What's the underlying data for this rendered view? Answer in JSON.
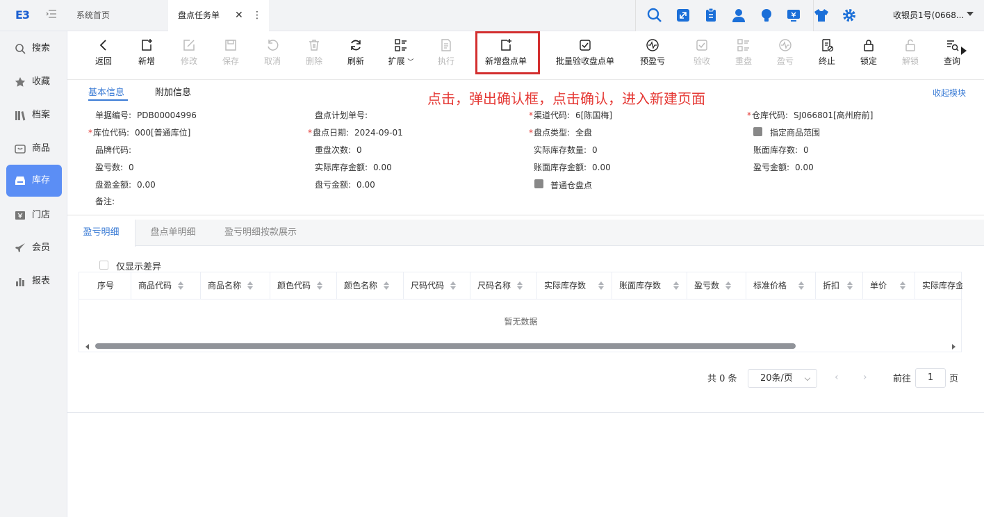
{
  "logo": "E3",
  "tabs": {
    "home": "系统首页",
    "task": "盘点任务单"
  },
  "user": {
    "name": "收银员1号(0668..."
  },
  "sidebar": {
    "items": [
      {
        "label": "搜索",
        "icon": "search-icon"
      },
      {
        "label": "收藏",
        "icon": "star-icon"
      },
      {
        "label": "档案",
        "icon": "books-icon"
      },
      {
        "label": "商品",
        "icon": "product-icon"
      },
      {
        "label": "库存",
        "icon": "inventory-icon"
      },
      {
        "label": "门店",
        "icon": "store-icon"
      },
      {
        "label": "会员",
        "icon": "member-icon"
      },
      {
        "label": "报表",
        "icon": "report-icon"
      }
    ]
  },
  "toolbar": {
    "back": "返回",
    "add": "新增",
    "edit": "修改",
    "save": "保存",
    "cancel": "取消",
    "delete": "删除",
    "refresh": "刷新",
    "expand": "扩展",
    "execute": "执行",
    "new_count": "新增盘点单",
    "batch_verify": "批量验收盘点单",
    "pre_profit": "预盈亏",
    "verify": "验收",
    "recount": "重盘",
    "profit": "盈亏",
    "terminate": "终止",
    "lock": "锁定",
    "unlock": "解锁",
    "query": "查询"
  },
  "form": {
    "tab_basic": "基本信息",
    "tab_extra": "附加信息",
    "collapse": "收起模块",
    "annotation": "点击，弹出确认框，点击确认，进入新建页面",
    "doc_no_label": "单据编号:",
    "doc_no": "PDB00004996",
    "plan_no_label": "盘点计划单号:",
    "channel_label": "渠道代码:",
    "channel": "6[陈国梅]",
    "warehouse_label": "仓库代码:",
    "warehouse": "SJ066801[高州府前]",
    "location_label": "库位代码:",
    "location": "000[普通库位]",
    "date_label": "盘点日期:",
    "date": "2024-09-01",
    "type_label": "盘点类型:",
    "type": "全盘",
    "spec_range": "指定商品范围",
    "brand_label": "品牌代码:",
    "recount_label": "重盘次数:",
    "recount": "0",
    "actual_qty_label": "实际库存数量:",
    "actual_qty": "0",
    "book_qty_label": "账面库存数:",
    "book_qty": "0",
    "profit_qty_label": "盈亏数:",
    "profit_qty": "0",
    "actual_amt_label": "实际库存金额:",
    "actual_amt": "0.00",
    "book_amt_label": "账面库存金额:",
    "book_amt": "0.00",
    "profit_amt_label": "盈亏金额:",
    "profit_amt": "0.00",
    "surplus_amt_label": "盘盈金额:",
    "surplus_amt": "0.00",
    "loss_amt_label": "盘亏金额:",
    "loss_amt": "0.00",
    "normal_wh": "普通仓盘点",
    "remark_label": "备注:"
  },
  "detail": {
    "tabs": [
      "盈亏明细",
      "盘点单明细",
      "盈亏明细按款展示"
    ],
    "only_diff": "仅显示差异",
    "columns": [
      "序号",
      "商品代码",
      "商品名称",
      "颜色代码",
      "颜色名称",
      "尺码代码",
      "尺码名称",
      "实际库存数",
      "账面库存数",
      "盈亏数",
      "标准价格",
      "折扣",
      "单价",
      "实际库存金"
    ],
    "empty": "暂无数据"
  },
  "pager": {
    "total": "共 0 条",
    "size": "20条/页",
    "goto": "前往",
    "page": "1",
    "page_suffix": "页"
  },
  "colors": {
    "accent": "#3a7bd5",
    "active_side": "#5b8ef5",
    "annotation": "#e53935",
    "icon_blue": "#1b6fd8"
  }
}
